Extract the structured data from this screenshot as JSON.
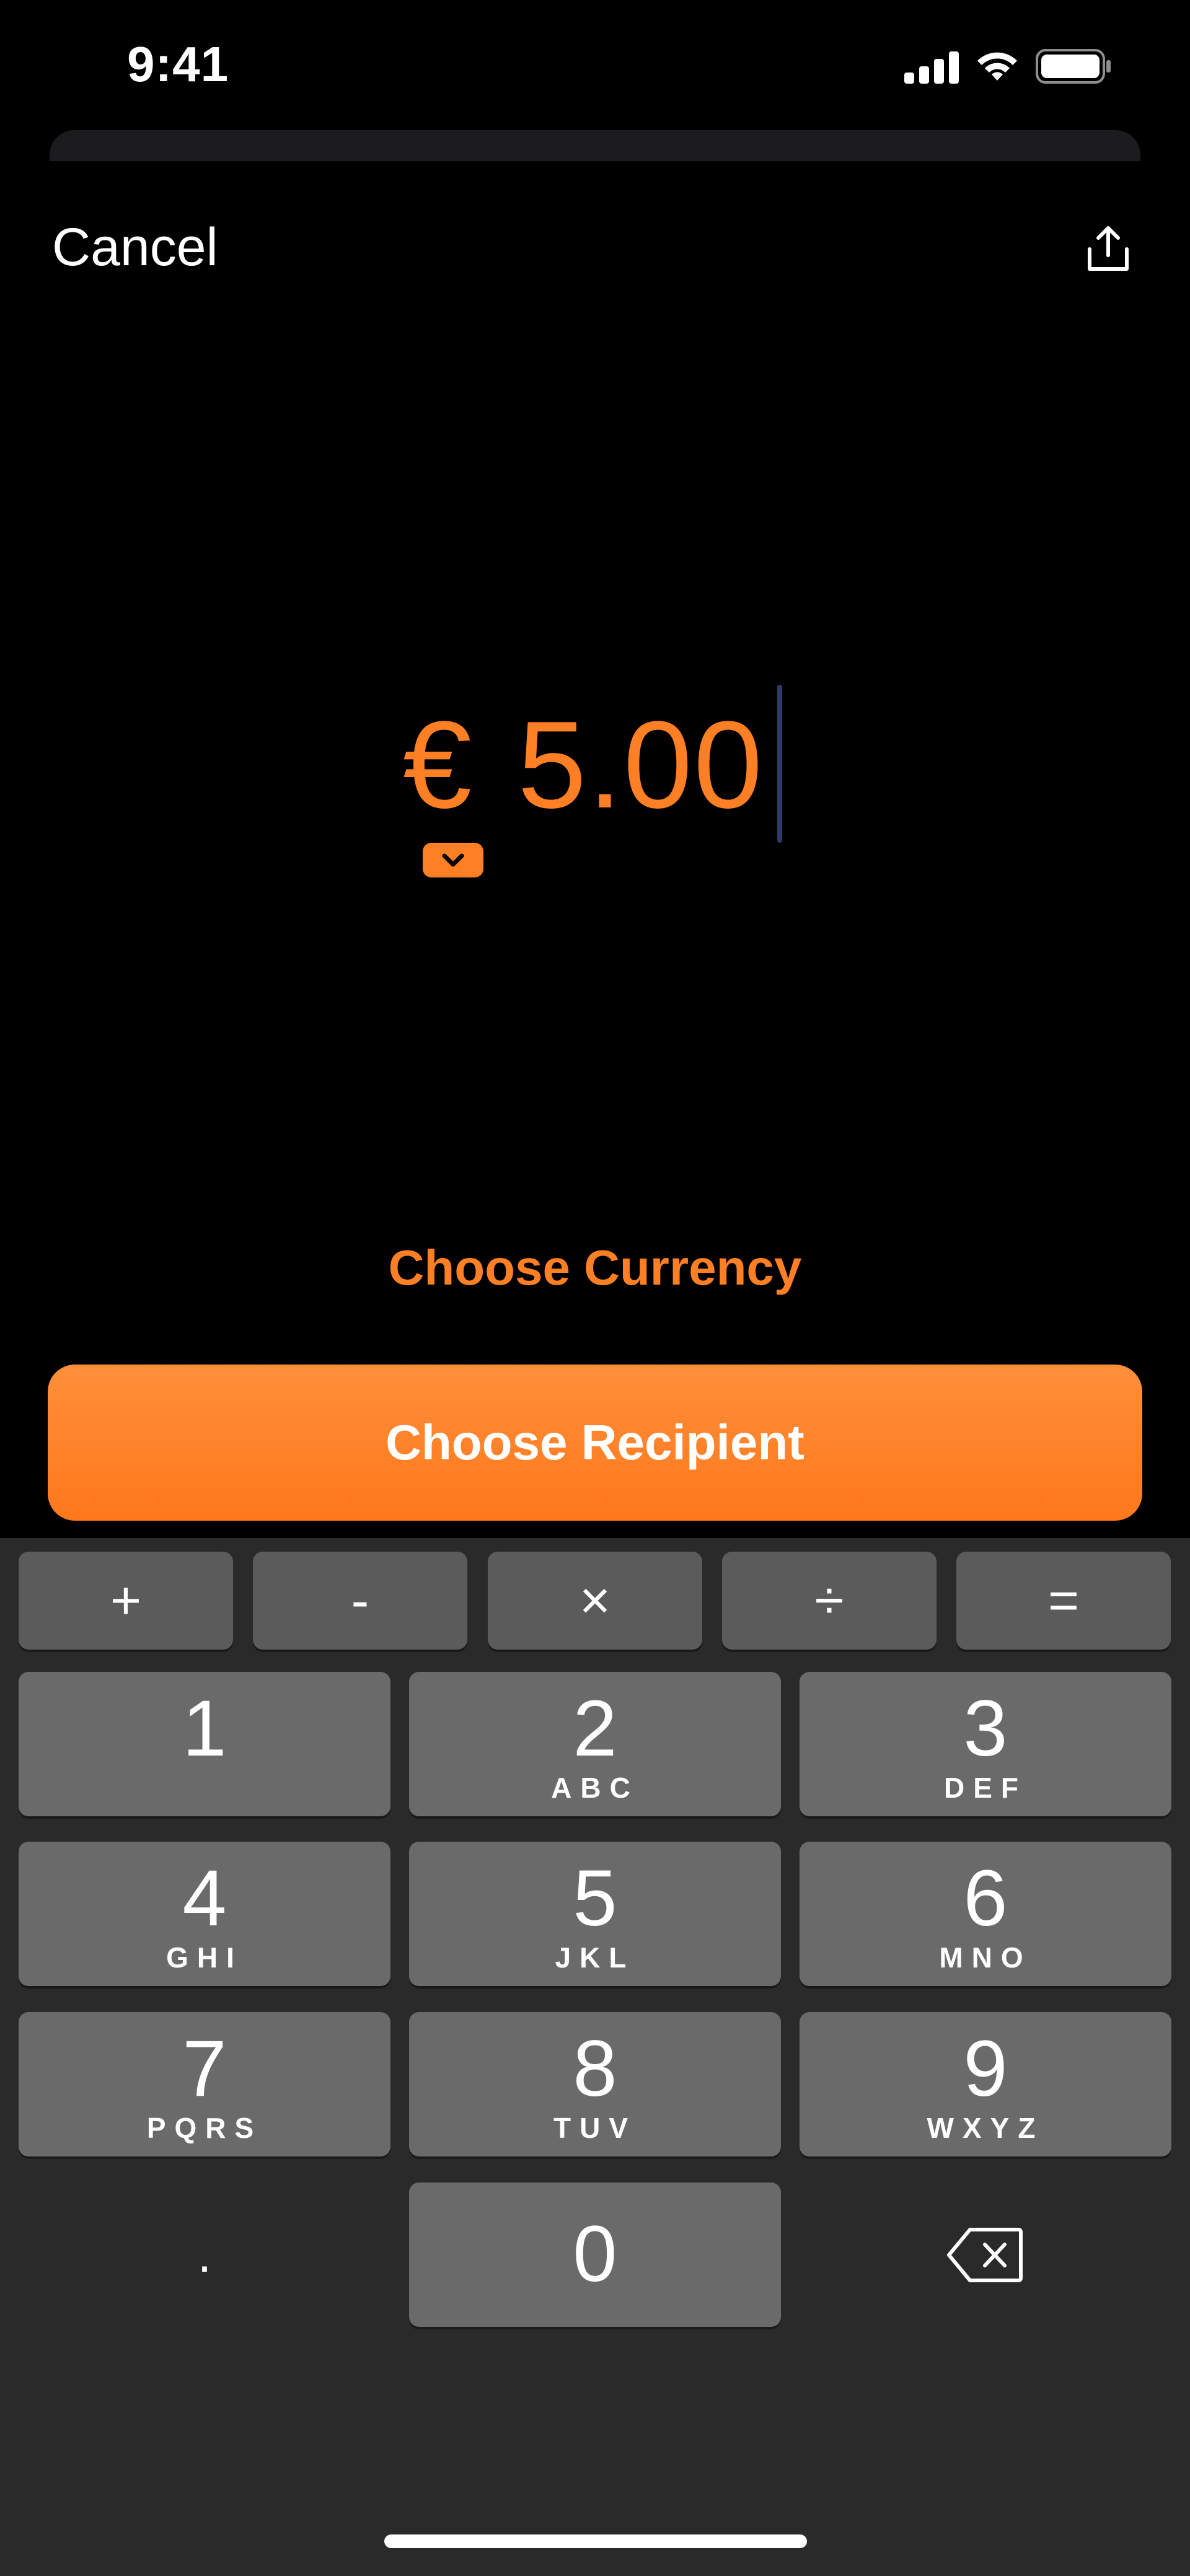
{
  "status_bar": {
    "time": "9:41",
    "icons": [
      "signal-icon",
      "wifi-icon",
      "battery-icon"
    ]
  },
  "nav": {
    "cancel_label": "Cancel",
    "share_icon": "share-icon"
  },
  "amount": {
    "currency_symbol": "€",
    "value": "5.00"
  },
  "actions": {
    "choose_currency": "Choose Currency",
    "choose_recipient": "Choose Recipient"
  },
  "keyboard": {
    "operators": [
      "+",
      "-",
      "×",
      "÷",
      "="
    ],
    "keys": [
      {
        "digit": "1",
        "letters": ""
      },
      {
        "digit": "2",
        "letters": "ABC"
      },
      {
        "digit": "3",
        "letters": "DEF"
      },
      {
        "digit": "4",
        "letters": "GHI"
      },
      {
        "digit": "5",
        "letters": "JKL"
      },
      {
        "digit": "6",
        "letters": "MNO"
      },
      {
        "digit": "7",
        "letters": "PQRS"
      },
      {
        "digit": "8",
        "letters": "TUV"
      },
      {
        "digit": "9",
        "letters": "WXYZ"
      }
    ],
    "zero": "0",
    "decimal": "."
  },
  "colors": {
    "accent": "#ff7f24",
    "background": "#000000",
    "keyboard": "#2a2a2a",
    "key": "#6a6a6a"
  }
}
